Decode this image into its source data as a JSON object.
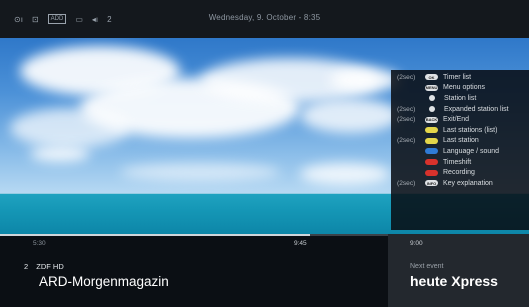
{
  "status_bar": {
    "icons": [
      {
        "name": "recording-indicator-icon",
        "glyph": "⊙ı"
      },
      {
        "name": "subtitles-icon",
        "glyph": "⊡"
      },
      {
        "name": "audio-format-icon",
        "glyph": "ADD"
      },
      {
        "name": "hd-icon",
        "glyph": "▭"
      },
      {
        "name": "volume-icon",
        "glyph": "◂ı"
      }
    ],
    "volume_value": "2",
    "datetime": "Wednesday, 9. October - 8:35"
  },
  "key_help": {
    "items": [
      {
        "hold": "(2sec)",
        "button_color": "#dfe2e5",
        "button_text": "OK",
        "round": false,
        "label": "Timer list"
      },
      {
        "hold": "",
        "button_color": "#dfe2e5",
        "button_text": "MENU",
        "round": false,
        "label": "Menu options"
      },
      {
        "hold": "",
        "button_color": "#dfe2e5",
        "button_text": "",
        "round": true,
        "label": "Station list"
      },
      {
        "hold": "(2sec)",
        "button_color": "#dfe2e5",
        "button_text": "",
        "round": true,
        "label": "Expanded station list"
      },
      {
        "hold": "(2sec)",
        "button_color": "#dfe2e5",
        "button_text": "BACK",
        "round": false,
        "label": "Exit/End"
      },
      {
        "hold": "",
        "button_color": "#e3d64a",
        "button_text": "",
        "round": false,
        "label": "Last stations (list)"
      },
      {
        "hold": "(2sec)",
        "button_color": "#e3d64a",
        "button_text": "",
        "round": false,
        "label": "Last station"
      },
      {
        "hold": "",
        "button_color": "#2f7bd6",
        "button_text": "",
        "round": false,
        "label": "Language / sound"
      },
      {
        "hold": "",
        "button_color": "#d8322c",
        "button_text": "",
        "round": false,
        "label": "Timeshift"
      },
      {
        "hold": "",
        "button_color": "#d8322c",
        "button_text": "",
        "round": false,
        "label": "Recording"
      },
      {
        "hold": "(2sec)",
        "button_color": "#dfe2e5",
        "button_text": "INFO",
        "round": false,
        "label": "Key explanation"
      }
    ]
  },
  "current_programme": {
    "start_time": "5:30",
    "end_time": "9:45",
    "progress": 0.8,
    "channel_number": "2",
    "channel_name": "ZDF HD",
    "title": "ARD-Morgenmagazin"
  },
  "next_programme": {
    "start_time": "9:00",
    "label": "Next event",
    "title": "heute Xpress"
  }
}
